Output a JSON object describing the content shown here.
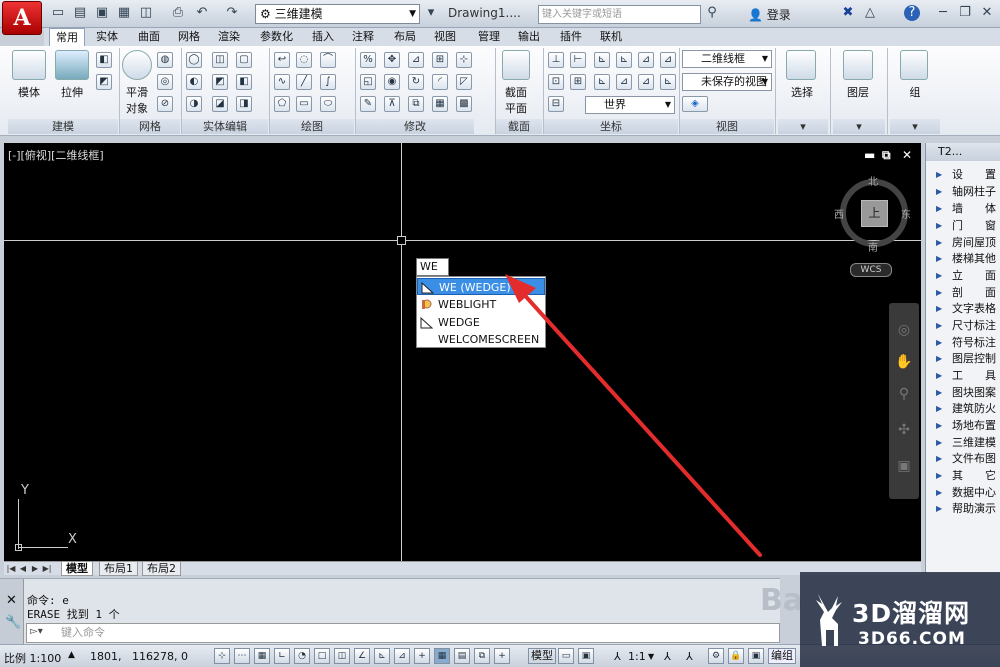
{
  "titlebar": {
    "app_letter": "A",
    "workspace": "三维建模",
    "doc_title": "Drawing1....",
    "search_placeholder": "键入关键字或短语",
    "login_label": "登录"
  },
  "tabs": [
    "常用",
    "实体",
    "曲面",
    "网格",
    "渲染",
    "参数化",
    "插入",
    "注释",
    "布局",
    "视图",
    "管理",
    "输出",
    "插件",
    "联机"
  ],
  "ribbon": {
    "model_label": "模体",
    "extrude_label": "拉伸",
    "smooth_label_1": "平滑",
    "smooth_label_2": "对象",
    "section_label_1": "截面",
    "section_label_2": "平面",
    "select_label": "选择",
    "layer_label": "图层",
    "group_label": "组",
    "visual_style": "二维线框",
    "view_combo": "未保存的视图",
    "ucs_combo": "世界",
    "panels": [
      "建模",
      "网格",
      "实体编辑",
      "绘图",
      "修改",
      "截面",
      "坐标",
      "视图"
    ]
  },
  "viewport": {
    "label": "[-][俯视][二维线框]",
    "compass": {
      "north": "北",
      "south": "南",
      "west": "西",
      "east": "东",
      "top": "上"
    },
    "wcs": "WCS",
    "ucs_x": "X",
    "ucs_y": "Y"
  },
  "autocomplete": {
    "typed": "WE",
    "items": [
      "WE (WEDGE)",
      "WEBLIGHT",
      "WEDGE",
      "WELCOMESCREEN"
    ],
    "selected_index": 0
  },
  "layout_tabs": [
    "模型",
    "布局1",
    "布局2"
  ],
  "command": {
    "history_1": "命令: e",
    "history_2": "ERASE 找到 1 个",
    "input_placeholder": "键入命令"
  },
  "status": {
    "scale": "比例 1:100",
    "coord_x": "1801,",
    "coord_rest": "116278, 0",
    "model_btn": "模型",
    "annot_scale": "1:1",
    "workspace_btn": "编组"
  },
  "tool_palette": {
    "title": "T2...",
    "items": [
      "设　　置",
      "轴网柱子",
      "墙　　体",
      "门　　窗",
      "房间屋顶",
      "楼梯其他",
      "立　　面",
      "剖　　面",
      "文字表格",
      "尺寸标注",
      "符号标注",
      "图层控制",
      "工　　具",
      "图块图案",
      "建筑防火",
      "场地布置",
      "三维建模",
      "文件布图",
      "其　　它",
      "数据中心",
      "帮助演示"
    ]
  },
  "watermark": {
    "brand": "3D溜溜网",
    "url": "3D66.COM",
    "ghost": "Ba"
  },
  "colors": {
    "accent_red": "#e32c2c",
    "highlight": "#3a8ee6",
    "canvas": "#000000"
  }
}
